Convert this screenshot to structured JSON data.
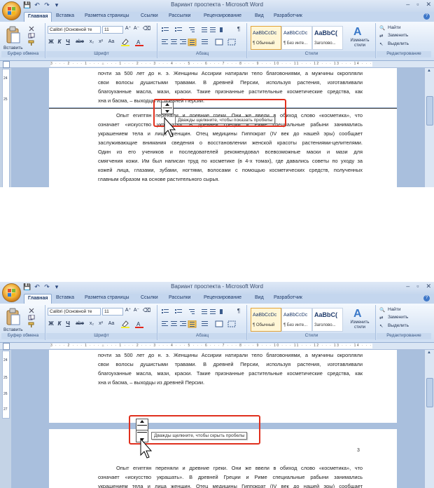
{
  "window": {
    "title": "Вариант проспекта - Microsoft Word",
    "controls": [
      "–",
      "▫",
      "✕"
    ]
  },
  "qat": {
    "save": "💾",
    "undo": "↶",
    "redo": "↷",
    "more": "▾"
  },
  "tabs": [
    "Главная",
    "Вставка",
    "Разметка страницы",
    "Ссылки",
    "Рассылки",
    "Рецензирование",
    "Вид",
    "Разработчик"
  ],
  "ribbon": {
    "clipboard": {
      "label": "Буфер обмена",
      "paste": "Вставить"
    },
    "font": {
      "label": "Шрифт",
      "font_name": "Calibri (Основной те",
      "font_size": "11",
      "grow": "A⁺",
      "shrink": "A⁻",
      "bold": "Ж",
      "italic": "К",
      "underline": "Ч",
      "strike": "abe",
      "subscript": "x₂",
      "superscript": "x²",
      "case": "Aa"
    },
    "paragraph": {
      "label": "Абзац",
      "show_marks": "¶"
    },
    "styles": {
      "label": "Стили",
      "items": [
        {
          "sample": "AaBbCcDc",
          "name": "¶ Обычный"
        },
        {
          "sample": "AaBbCcDc",
          "name": "¶ Без инте..."
        },
        {
          "sample": "AaBbC(",
          "name": "Заголово..."
        }
      ],
      "change": "Изменить стили"
    },
    "editing": {
      "label": "Редактирование",
      "find": "Найти",
      "replace": "Заменить",
      "select": "Выделить"
    }
  },
  "ruler": {
    "ticks": "3 · · · 2 · · · 1 · · · ⌂ · · · 1 · · · 2 · · · 3 · · · 4 · · · 5 · · · 6 · · · 7 · · · 8 · · · 9 · · · 10 · · · 11 · · · 12 · · · 13 · · · 14 · · · 15 · · · 16 · · · 17",
    "v_ticks": [
      "24",
      "25",
      "26",
      "27"
    ]
  },
  "doc": {
    "para_top": [
      "почти за 500 лет до н. э. Женщины Ассирии натирали тело благовониями, а мужчины окропляли",
      "свои волосы душистыми травами. В древней Персии, используя растения, изготавливали",
      "благоуханные масла, мази, краски. Такие признанные растительные косметические средства, как",
      "хна и басма, – выходцы из древней Персии."
    ],
    "para_bottom_s1": [
      "Опыт египтян переняли и древние греки. Они же ввели в обиход слово «косметика», что",
      "означает «искусство украшать». В древней Греции и Риме специальные рабыни занимались",
      "украшением тела и лица женщин. Отец медицины Гиппократ (IV век до нашей эры) сообщает",
      "заслуживающие внимания сведения о восстановлении женской красоты растениями-целителями.",
      "Один из его учеников и последователей рекомендовал всевозможные маски и мази для",
      "смягчения кожи. Им был написан труд по косметике (в 4-х томах), где давались советы по уходу за",
      "кожей лица, глазами, зубами, ногтями, волосами с помощью косметических средств, полученных",
      "главным образом на основе растительного сырья."
    ],
    "para_bottom_s2": [
      "Опыт египтян переняли и древние греки. Они же ввели в обиход слово «косметика», что",
      "означает «искусство украшать». В древней Греции и Риме специальные рабыни занимались",
      "украшением тела и лица женщин. Отец медицины Гиппократ (IV век до нашей эры) сообщает"
    ],
    "page_number": "3"
  },
  "tooltips": {
    "show_whitespace": "Дважды щелкните, чтобы показать пробелы",
    "hide_whitespace": "Дважды щелкните, чтобы скрыть пробелы"
  },
  "colors": {
    "accent": "#e0301e",
    "ribbon": "#dbe7f6",
    "doc_bg": "#a9bfdd"
  }
}
